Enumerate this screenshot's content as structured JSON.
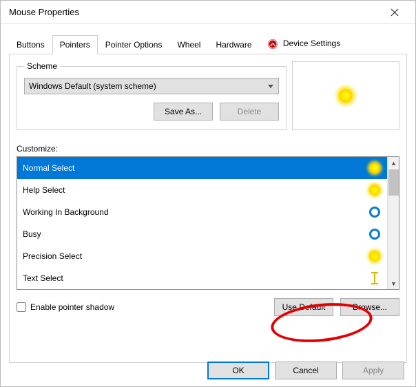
{
  "window": {
    "title": "Mouse Properties"
  },
  "tabs": {
    "buttons": "Buttons",
    "pointers": "Pointers",
    "pointer_options": "Pointer Options",
    "wheel": "Wheel",
    "hardware": "Hardware",
    "device_settings": "Device Settings"
  },
  "scheme": {
    "legend": "Scheme",
    "selected": "Windows Default (system scheme)",
    "save_as": "Save As...",
    "delete": "Delete"
  },
  "customize": {
    "label": "Customize:",
    "items": [
      {
        "label": "Normal Select",
        "icon": "yellow-filled",
        "selected": true
      },
      {
        "label": "Help Select",
        "icon": "yellow-filled",
        "selected": false
      },
      {
        "label": "Working In Background",
        "icon": "blue-ring",
        "selected": false
      },
      {
        "label": "Busy",
        "icon": "blue-ring",
        "selected": false
      },
      {
        "label": "Precision Select",
        "icon": "yellow-filled",
        "selected": false
      },
      {
        "label": "Text Select",
        "icon": "ibeam",
        "selected": false
      }
    ]
  },
  "options": {
    "enable_shadow": "Enable pointer shadow",
    "use_default": "Use Default",
    "browse": "Browse..."
  },
  "dialog_buttons": {
    "ok": "OK",
    "cancel": "Cancel",
    "apply": "Apply"
  }
}
